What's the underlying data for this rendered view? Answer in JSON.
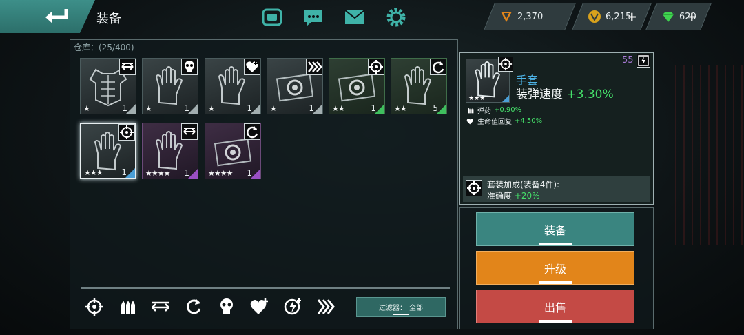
{
  "header": {
    "title": "装备",
    "icons": [
      "controller-icon",
      "chat-icon",
      "mail-icon",
      "gear-icon"
    ]
  },
  "currencies": [
    {
      "name": "orange-rank-icon",
      "value": "2,370",
      "color": "#e2851a",
      "has_plus": false
    },
    {
      "name": "gold-coin-icon",
      "value": "6,215",
      "color": "#d9a21c",
      "has_plus": true
    },
    {
      "name": "gem-icon",
      "value": "620",
      "color": "#3fd34f",
      "has_plus": true
    }
  ],
  "warehouse": {
    "label": "仓库：(25/400)",
    "items": [
      {
        "type": "armor",
        "stars": "★",
        "count": "1",
        "badge": "range-icon",
        "rarity": "gray"
      },
      {
        "type": "glove",
        "stars": "★",
        "count": "1",
        "badge": "skull-icon",
        "rarity": "gray"
      },
      {
        "type": "glove",
        "stars": "★",
        "count": "1",
        "badge": "heart-plus-icon",
        "rarity": "gray"
      },
      {
        "type": "core",
        "stars": "★",
        "count": "1",
        "badge": "chevrons-icon",
        "rarity": "gray"
      },
      {
        "type": "core",
        "stars": "★★",
        "count": "1",
        "badge": "crosshair-icon",
        "rarity": "green"
      },
      {
        "type": "glove",
        "stars": "★★",
        "count": "5",
        "badge": "reload-icon",
        "rarity": "green"
      },
      {
        "type": "glove",
        "stars": "★★★",
        "count": "1",
        "badge": "crosshair-icon",
        "rarity": "blue",
        "selected": true
      },
      {
        "type": "glove",
        "stars": "★★★★",
        "count": "1",
        "badge": "range-icon",
        "rarity": "purple"
      },
      {
        "type": "core",
        "stars": "★★★★",
        "count": "1",
        "badge": "reload-icon",
        "rarity": "purple"
      }
    ]
  },
  "filters": {
    "icons": [
      "crosshair-icon",
      "ammo-icon",
      "range-icon",
      "reload-icon",
      "skull-icon",
      "heart-plus-icon",
      "lightning-icon",
      "chevrons-icon"
    ],
    "filter_label": "过滤器：",
    "filter_value": "全部"
  },
  "detail": {
    "level": "55",
    "name": "手套",
    "main_stat_label": "装弹速度",
    "main_stat_value": "+3.30%",
    "sub_stats": [
      {
        "icon": "ammo-icon",
        "label": "弹药",
        "value": "+0.90%"
      },
      {
        "icon": "heart-plus-icon",
        "label": "生命值回复",
        "value": "+4.50%"
      }
    ],
    "set_title": "套装加成(装备4件):",
    "set_bonus_label": "准确度",
    "set_bonus_value": "+20%"
  },
  "actions": {
    "equip": "装备",
    "upgrade": "升级",
    "sell": "出售"
  }
}
